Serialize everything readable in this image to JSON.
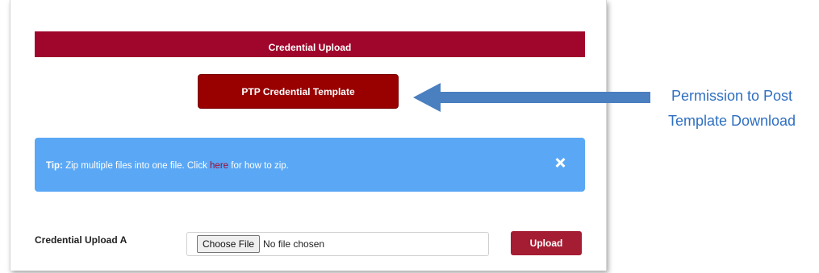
{
  "header": {
    "title": "Credential Upload"
  },
  "template_button": {
    "label": "PTP Credential Template"
  },
  "tip": {
    "prefix": "Tip:",
    "text_before": " Zip multiple files into one file. Click ",
    "link": "here",
    "text_after": " for how to zip."
  },
  "upload": {
    "label": "Credential Upload A",
    "choose_label": "Choose File",
    "no_file_text": "No file chosen",
    "upload_label": "Upload"
  },
  "annotation": {
    "line1": "Permission to Post",
    "line2": "Template Download"
  },
  "colors": {
    "header": "#a0052b",
    "template_button": "#990000",
    "tip_bg": "#5aa8f5",
    "upload_button": "#a51d33",
    "arrow": "#4a7fc0",
    "annotation_text": "#2f6fc1"
  },
  "icons": {
    "close": "close-icon",
    "arrow": "left-arrow-icon"
  }
}
